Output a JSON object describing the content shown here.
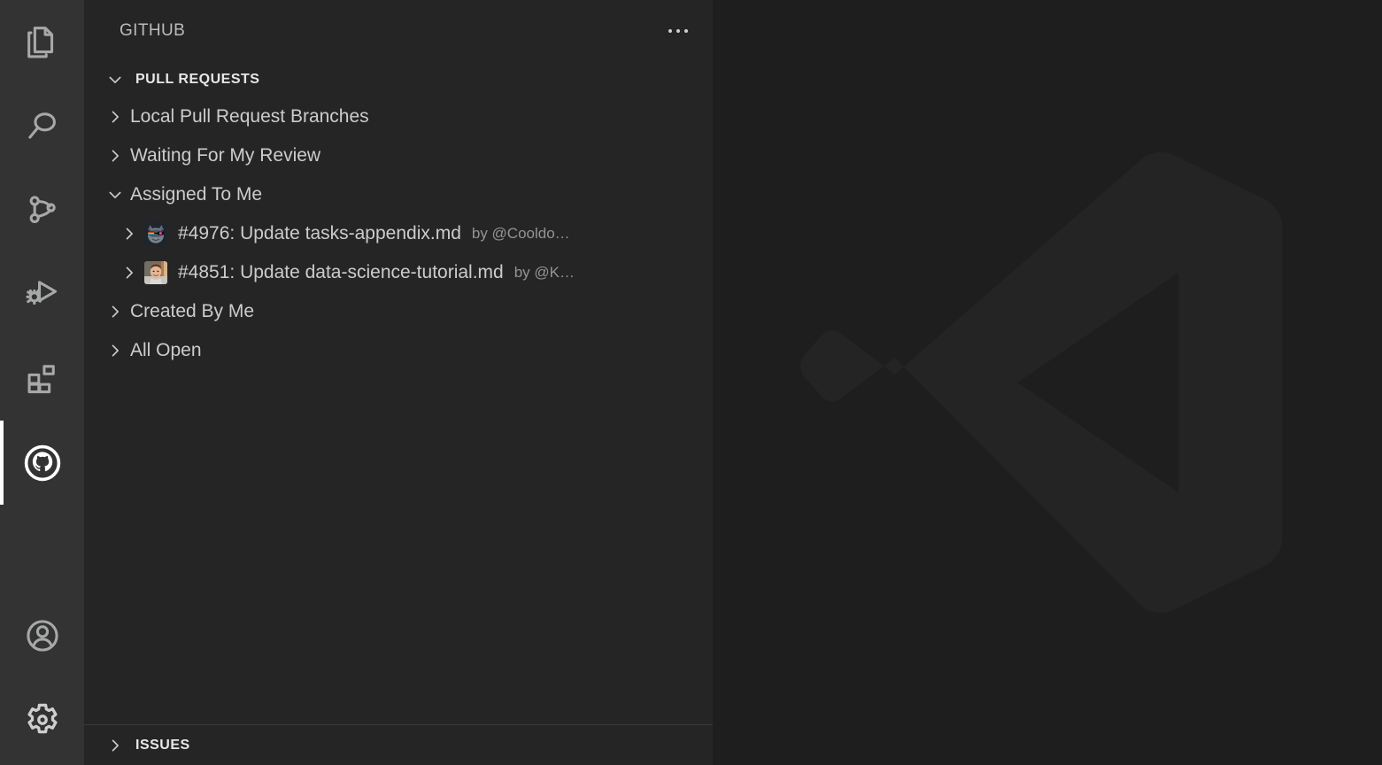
{
  "activity_bar": {
    "items": [
      {
        "name": "explorer",
        "icon": "files-icon",
        "label": "Explorer",
        "active": false
      },
      {
        "name": "search",
        "icon": "search-icon",
        "label": "Search",
        "active": false
      },
      {
        "name": "source-control",
        "icon": "source-control-icon",
        "label": "Source Control",
        "active": false
      },
      {
        "name": "run-debug",
        "icon": "run-and-debug-icon",
        "label": "Run and Debug",
        "active": false
      },
      {
        "name": "extensions",
        "icon": "extensions-icon",
        "label": "Extensions",
        "active": false
      },
      {
        "name": "github",
        "icon": "github-icon",
        "label": "GitHub",
        "active": true
      }
    ],
    "bottom_items": [
      {
        "name": "accounts",
        "icon": "account-icon",
        "label": "Accounts"
      },
      {
        "name": "settings",
        "icon": "gear-icon",
        "label": "Manage"
      }
    ],
    "active_indicator_color": "#ffffff",
    "background": "#333333"
  },
  "sidebar": {
    "title": "GITHUB",
    "more_actions_label": "Views and More Actions...",
    "background": "#252526",
    "pull_requests": {
      "header": "PULL REQUESTS",
      "expanded": true,
      "items": [
        {
          "label": "Local Pull Request Branches",
          "expanded": false,
          "level": 1
        },
        {
          "label": "Waiting For My Review",
          "expanded": false,
          "level": 1
        },
        {
          "label": "Assigned To Me",
          "expanded": true,
          "level": 1
        },
        {
          "label": "#4976: Update tasks-appendix.md",
          "sublabel": "by @Cooldo…",
          "expanded": false,
          "level": 2,
          "avatar": "cat-avatar"
        },
        {
          "label": "#4851: Update data-science-tutorial.md",
          "sublabel": "by @K…",
          "expanded": false,
          "level": 2,
          "avatar": "person-avatar"
        },
        {
          "label": "Created By Me",
          "expanded": false,
          "level": 1
        },
        {
          "label": "All Open",
          "expanded": false,
          "level": 1
        }
      ]
    },
    "issues": {
      "header": "ISSUES",
      "expanded": false
    }
  },
  "editor": {
    "background": "#1e1e1e",
    "watermark_icon": "vscode-logo-watermark",
    "watermark_color": "#242424"
  }
}
